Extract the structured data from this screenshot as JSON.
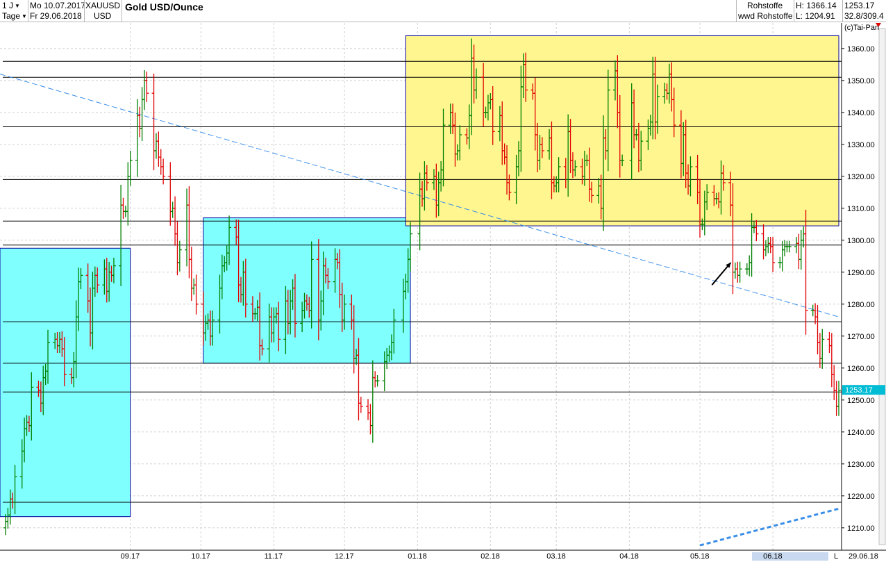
{
  "header": {
    "period": "1 J",
    "date_from": "Mo 10.07.2017",
    "date_to": "Fr 29.06.2018",
    "interval": "Tage",
    "symbol": "XAUUSD",
    "currency": "USD",
    "title": "Gold USD/Ounce",
    "group": "Rohstoffe",
    "group_source": "wwd Rohstoffe",
    "high": "H: 1366.14",
    "low": "L: 1204.91",
    "last": "1253.17",
    "range": "32.8/309.4",
    "copyright": "(c)Tai-Pan"
  },
  "footer": {
    "period_label": "06.18",
    "end_date": "29.06.18",
    "scale_mode": "L"
  },
  "chart_data": {
    "type": "ohlc",
    "title": "Gold USD/Ounce",
    "last_price": 1253.17,
    "ylim": [
      1203,
      1368
    ],
    "y_ticks": [
      1210,
      1220,
      1230,
      1240,
      1250,
      1260,
      1270,
      1280,
      1290,
      1300,
      1310,
      1320,
      1330,
      1340,
      1350,
      1360
    ],
    "y_tick_labels": [
      "1210.00",
      "1220.00",
      "1230.00",
      "1240.00",
      "1250.00",
      "1260.00",
      "1270.00",
      "1280.00",
      "1290.00",
      "1300.00",
      "1310.00",
      "1320.00",
      "1330.00",
      "1340.00",
      "1350.00",
      "1360.00"
    ],
    "x_ticks": [
      "09.17",
      "10.17",
      "11.17",
      "12.17",
      "01.18",
      "02.18",
      "03.18",
      "04.18",
      "05.18",
      "06.18"
    ],
    "grid": true,
    "colors": {
      "up": "#008000",
      "down": "#e00000",
      "yellow_zone": "#fff68f",
      "cyan_zone": "#80ffff",
      "zone_border": "#0000a0",
      "trendline": "#3a8ee6",
      "price_tag": "#00bcd4"
    },
    "horizontal_levels": [
      1218,
      1252.5,
      1261.5,
      1274.5,
      1298.5,
      1306,
      1319,
      1335.5,
      1351,
      1356
    ],
    "zones": [
      {
        "color": "cyan",
        "from": "2017-07-10",
        "to": "2017-09-01",
        "low": 1213.5,
        "high": 1297.5
      },
      {
        "color": "cyan",
        "from": "2017-10-02",
        "to": "2017-12-29",
        "low": 1261.5,
        "high": 1307
      },
      {
        "color": "yellow",
        "from": "2017-12-27",
        "to": "2018-06-29",
        "low": 1304.5,
        "high": 1364
      }
    ],
    "trendlines": [
      {
        "style": "dashed",
        "from": [
          "2017-07-10",
          1352
        ],
        "to": [
          "2018-06-29",
          1276
        ]
      },
      {
        "style": "dashed-bold",
        "from": [
          "2018-05-01",
          1204.5
        ],
        "to": [
          "2018-06-29",
          1216
        ]
      }
    ],
    "annotation_arrow": {
      "from": [
        "2018-05-02",
        1286
      ],
      "to": [
        "2018-05-10",
        1293
      ]
    },
    "series": [
      {
        "t": "2017-07-10",
        "c": 1212
      },
      {
        "t": "2017-07-11",
        "c": 1214
      },
      {
        "t": "2017-07-12",
        "c": 1219
      },
      {
        "t": "2017-07-13",
        "c": 1218
      },
      {
        "t": "2017-07-14",
        "c": 1226
      },
      {
        "t": "2017-07-17",
        "c": 1234
      },
      {
        "t": "2017-07-18",
        "c": 1241
      },
      {
        "t": "2017-07-19",
        "c": 1243
      },
      {
        "t": "2017-07-20",
        "c": 1242
      },
      {
        "t": "2017-07-21",
        "c": 1254
      },
      {
        "t": "2017-07-24",
        "c": 1253
      },
      {
        "t": "2017-07-25",
        "c": 1249
      },
      {
        "t": "2017-07-26",
        "c": 1257
      },
      {
        "t": "2017-07-27",
        "c": 1259
      },
      {
        "t": "2017-07-28",
        "c": 1268
      },
      {
        "t": "2017-07-31",
        "c": 1269
      },
      {
        "t": "2017-08-01",
        "c": 1267
      },
      {
        "t": "2017-08-02",
        "c": 1269
      },
      {
        "t": "2017-08-03",
        "c": 1266
      },
      {
        "t": "2017-08-04",
        "c": 1258
      },
      {
        "t": "2017-08-07",
        "c": 1257
      },
      {
        "t": "2017-08-08",
        "c": 1262
      },
      {
        "t": "2017-08-09",
        "c": 1276
      },
      {
        "t": "2017-08-10",
        "c": 1287
      },
      {
        "t": "2017-08-11",
        "c": 1289
      },
      {
        "t": "2017-08-14",
        "c": 1281
      },
      {
        "t": "2017-08-15",
        "c": 1271
      },
      {
        "t": "2017-08-16",
        "c": 1285
      },
      {
        "t": "2017-08-17",
        "c": 1289
      },
      {
        "t": "2017-08-18",
        "c": 1286
      },
      {
        "t": "2017-08-21",
        "c": 1291
      },
      {
        "t": "2017-08-22",
        "c": 1284
      },
      {
        "t": "2017-08-23",
        "c": 1290
      },
      {
        "t": "2017-08-24",
        "c": 1289
      },
      {
        "t": "2017-08-25",
        "c": 1292
      },
      {
        "t": "2017-08-28",
        "c": 1311
      },
      {
        "t": "2017-08-29",
        "c": 1309
      },
      {
        "t": "2017-08-30",
        "c": 1309
      },
      {
        "t": "2017-08-31",
        "c": 1320
      },
      {
        "t": "2017-09-01",
        "c": 1325
      },
      {
        "t": "2017-09-04",
        "c": 1339
      },
      {
        "t": "2017-09-05",
        "c": 1335
      },
      {
        "t": "2017-09-06",
        "c": 1344
      },
      {
        "t": "2017-09-07",
        "c": 1350
      },
      {
        "t": "2017-09-08",
        "c": 1346
      },
      {
        "t": "2017-09-11",
        "c": 1328
      },
      {
        "t": "2017-09-12",
        "c": 1331
      },
      {
        "t": "2017-09-13",
        "c": 1326
      },
      {
        "t": "2017-09-14",
        "c": 1323
      },
      {
        "t": "2017-09-15",
        "c": 1320
      },
      {
        "t": "2017-09-18",
        "c": 1309
      },
      {
        "t": "2017-09-19",
        "c": 1310
      },
      {
        "t": "2017-09-20",
        "c": 1302
      },
      {
        "t": "2017-09-21",
        "c": 1293
      },
      {
        "t": "2017-09-22",
        "c": 1297
      },
      {
        "t": "2017-09-25",
        "c": 1311
      },
      {
        "t": "2017-09-26",
        "c": 1294
      },
      {
        "t": "2017-09-27",
        "c": 1285
      },
      {
        "t": "2017-09-28",
        "c": 1286
      },
      {
        "t": "2017-09-29",
        "c": 1280
      },
      {
        "t": "2017-10-02",
        "c": 1271
      },
      {
        "t": "2017-10-03",
        "c": 1274
      },
      {
        "t": "2017-10-04",
        "c": 1275
      },
      {
        "t": "2017-10-05",
        "c": 1270
      },
      {
        "t": "2017-10-06",
        "c": 1275
      },
      {
        "t": "2017-10-09",
        "c": 1285
      },
      {
        "t": "2017-10-10",
        "c": 1292
      },
      {
        "t": "2017-10-11",
        "c": 1293
      },
      {
        "t": "2017-10-12",
        "c": 1296
      },
      {
        "t": "2017-10-13",
        "c": 1304
      },
      {
        "t": "2017-10-16",
        "c": 1301
      },
      {
        "t": "2017-10-17",
        "c": 1286
      },
      {
        "t": "2017-10-18",
        "c": 1283
      },
      {
        "t": "2017-10-19",
        "c": 1290
      },
      {
        "t": "2017-10-20",
        "c": 1280
      },
      {
        "t": "2017-10-23",
        "c": 1277
      },
      {
        "t": "2017-10-24",
        "c": 1277
      },
      {
        "t": "2017-10-25",
        "c": 1279
      },
      {
        "t": "2017-10-26",
        "c": 1267
      },
      {
        "t": "2017-10-27",
        "c": 1266
      },
      {
        "t": "2017-10-30",
        "c": 1276
      },
      {
        "t": "2017-10-31",
        "c": 1271
      },
      {
        "t": "2017-11-01",
        "c": 1276
      },
      {
        "t": "2017-11-02",
        "c": 1277
      },
      {
        "t": "2017-11-03",
        "c": 1269
      },
      {
        "t": "2017-11-06",
        "c": 1281
      },
      {
        "t": "2017-11-07",
        "c": 1274
      },
      {
        "t": "2017-11-08",
        "c": 1281
      },
      {
        "t": "2017-11-09",
        "c": 1285
      },
      {
        "t": "2017-11-10",
        "c": 1274
      },
      {
        "t": "2017-11-13",
        "c": 1278
      },
      {
        "t": "2017-11-14",
        "c": 1281
      },
      {
        "t": "2017-11-15",
        "c": 1280
      },
      {
        "t": "2017-11-16",
        "c": 1278
      },
      {
        "t": "2017-11-17",
        "c": 1294
      },
      {
        "t": "2017-11-20",
        "c": 1275
      },
      {
        "t": "2017-11-21",
        "c": 1281
      },
      {
        "t": "2017-11-22",
        "c": 1292
      },
      {
        "t": "2017-11-23",
        "c": 1289
      },
      {
        "t": "2017-11-24",
        "c": 1287
      },
      {
        "t": "2017-11-27",
        "c": 1294
      },
      {
        "t": "2017-11-28",
        "c": 1293
      },
      {
        "t": "2017-11-29",
        "c": 1283
      },
      {
        "t": "2017-11-30",
        "c": 1275
      },
      {
        "t": "2017-12-01",
        "c": 1280
      },
      {
        "t": "2017-12-04",
        "c": 1275
      },
      {
        "t": "2017-12-05",
        "c": 1263
      },
      {
        "t": "2017-12-06",
        "c": 1264
      },
      {
        "t": "2017-12-07",
        "c": 1249
      },
      {
        "t": "2017-12-08",
        "c": 1248
      },
      {
        "t": "2017-12-11",
        "c": 1246
      },
      {
        "t": "2017-12-12",
        "c": 1242
      },
      {
        "t": "2017-12-13",
        "c": 1257
      },
      {
        "t": "2017-12-14",
        "c": 1256
      },
      {
        "t": "2017-12-15",
        "c": 1256
      },
      {
        "t": "2017-12-18",
        "c": 1262
      },
      {
        "t": "2017-12-19",
        "c": 1264
      },
      {
        "t": "2017-12-20",
        "c": 1265
      },
      {
        "t": "2017-12-21",
        "c": 1268
      },
      {
        "t": "2017-12-22",
        "c": 1275
      },
      {
        "t": "2017-12-26",
        "c": 1284
      },
      {
        "t": "2017-12-27",
        "c": 1287
      },
      {
        "t": "2017-12-28",
        "c": 1294
      },
      {
        "t": "2017-12-29",
        "c": 1302
      },
      {
        "t": "2018-01-02",
        "c": 1316
      },
      {
        "t": "2018-01-03",
        "c": 1313
      },
      {
        "t": "2018-01-04",
        "c": 1321
      },
      {
        "t": "2018-01-05",
        "c": 1318
      },
      {
        "t": "2018-01-08",
        "c": 1320
      },
      {
        "t": "2018-01-09",
        "c": 1311
      },
      {
        "t": "2018-01-10",
        "c": 1318
      },
      {
        "t": "2018-01-11",
        "c": 1322
      },
      {
        "t": "2018-01-12",
        "c": 1336
      },
      {
        "t": "2018-01-15",
        "c": 1340
      },
      {
        "t": "2018-01-16",
        "c": 1336
      },
      {
        "t": "2018-01-17",
        "c": 1327
      },
      {
        "t": "2018-01-18",
        "c": 1328
      },
      {
        "t": "2018-01-19",
        "c": 1333
      },
      {
        "t": "2018-01-22",
        "c": 1332
      },
      {
        "t": "2018-01-23",
        "c": 1339
      },
      {
        "t": "2018-01-24",
        "c": 1357
      },
      {
        "t": "2018-01-25",
        "c": 1347
      },
      {
        "t": "2018-01-26",
        "c": 1351
      },
      {
        "t": "2018-01-29",
        "c": 1340
      },
      {
        "t": "2018-01-30",
        "c": 1340
      },
      {
        "t": "2018-01-31",
        "c": 1343
      },
      {
        "t": "2018-02-01",
        "c": 1344
      },
      {
        "t": "2018-02-02",
        "c": 1334
      },
      {
        "t": "2018-02-05",
        "c": 1339
      },
      {
        "t": "2018-02-06",
        "c": 1328
      },
      {
        "t": "2018-02-07",
        "c": 1326
      },
      {
        "t": "2018-02-08",
        "c": 1318
      },
      {
        "t": "2018-02-09",
        "c": 1315
      },
      {
        "t": "2018-02-12",
        "c": 1323
      },
      {
        "t": "2018-02-13",
        "c": 1328
      },
      {
        "t": "2018-02-14",
        "c": 1348
      },
      {
        "t": "2018-02-15",
        "c": 1355
      },
      {
        "t": "2018-02-16",
        "c": 1347
      },
      {
        "t": "2018-02-19",
        "c": 1346
      },
      {
        "t": "2018-02-20",
        "c": 1333
      },
      {
        "t": "2018-02-21",
        "c": 1325
      },
      {
        "t": "2018-02-22",
        "c": 1330
      },
      {
        "t": "2018-02-23",
        "c": 1328
      },
      {
        "t": "2018-02-26",
        "c": 1332
      },
      {
        "t": "2018-02-27",
        "c": 1318
      },
      {
        "t": "2018-02-28",
        "c": 1317
      },
      {
        "t": "2018-03-01",
        "c": 1318
      },
      {
        "t": "2018-03-02",
        "c": 1323
      },
      {
        "t": "2018-03-05",
        "c": 1319
      },
      {
        "t": "2018-03-06",
        "c": 1334
      },
      {
        "t": "2018-03-07",
        "c": 1325
      },
      {
        "t": "2018-03-08",
        "c": 1322
      },
      {
        "t": "2018-03-09",
        "c": 1323
      },
      {
        "t": "2018-03-12",
        "c": 1320
      },
      {
        "t": "2018-03-13",
        "c": 1325
      },
      {
        "t": "2018-03-14",
        "c": 1325
      },
      {
        "t": "2018-03-15",
        "c": 1316
      },
      {
        "t": "2018-03-16",
        "c": 1314
      },
      {
        "t": "2018-03-19",
        "c": 1317
      },
      {
        "t": "2018-03-20",
        "c": 1310
      },
      {
        "t": "2018-03-21",
        "c": 1332
      },
      {
        "t": "2018-03-22",
        "c": 1328
      },
      {
        "t": "2018-03-23",
        "c": 1347
      },
      {
        "t": "2018-03-26",
        "c": 1353
      },
      {
        "t": "2018-03-27",
        "c": 1340
      },
      {
        "t": "2018-03-28",
        "c": 1325
      },
      {
        "t": "2018-03-29",
        "c": 1325
      },
      {
        "t": "2018-04-02",
        "c": 1343
      },
      {
        "t": "2018-04-03",
        "c": 1333
      },
      {
        "t": "2018-04-04",
        "c": 1333
      },
      {
        "t": "2018-04-05",
        "c": 1325
      },
      {
        "t": "2018-04-06",
        "c": 1331
      },
      {
        "t": "2018-04-09",
        "c": 1335
      },
      {
        "t": "2018-04-10",
        "c": 1337
      },
      {
        "t": "2018-04-11",
        "c": 1352
      },
      {
        "t": "2018-04-12",
        "c": 1337
      },
      {
        "t": "2018-04-13",
        "c": 1345
      },
      {
        "t": "2018-04-16",
        "c": 1347
      },
      {
        "t": "2018-04-17",
        "c": 1346
      },
      {
        "t": "2018-04-18",
        "c": 1352
      },
      {
        "t": "2018-04-19",
        "c": 1344
      },
      {
        "t": "2018-04-20",
        "c": 1336
      },
      {
        "t": "2018-04-23",
        "c": 1324
      },
      {
        "t": "2018-04-24",
        "c": 1333
      },
      {
        "t": "2018-04-25",
        "c": 1321
      },
      {
        "t": "2018-04-26",
        "c": 1317
      },
      {
        "t": "2018-04-27",
        "c": 1323
      },
      {
        "t": "2018-04-30",
        "c": 1315
      },
      {
        "t": "2018-05-01",
        "c": 1305
      },
      {
        "t": "2018-05-02",
        "c": 1305
      },
      {
        "t": "2018-05-03",
        "c": 1312
      },
      {
        "t": "2018-05-04",
        "c": 1315
      },
      {
        "t": "2018-05-07",
        "c": 1313
      },
      {
        "t": "2018-05-08",
        "c": 1313
      },
      {
        "t": "2018-05-09",
        "c": 1312
      },
      {
        "t": "2018-05-10",
        "c": 1321
      },
      {
        "t": "2018-05-11",
        "c": 1318
      },
      {
        "t": "2018-05-14",
        "c": 1311
      },
      {
        "t": "2018-05-15",
        "c": 1290
      },
      {
        "t": "2018-05-16",
        "c": 1291
      },
      {
        "t": "2018-05-17",
        "c": 1289
      },
      {
        "t": "2018-05-18",
        "c": 1291
      },
      {
        "t": "2018-05-21",
        "c": 1291
      },
      {
        "t": "2018-05-22",
        "c": 1293
      },
      {
        "t": "2018-05-23",
        "c": 1304
      },
      {
        "t": "2018-05-24",
        "c": 1304
      },
      {
        "t": "2018-05-25",
        "c": 1302
      },
      {
        "t": "2018-05-28",
        "c": 1297
      },
      {
        "t": "2018-05-29",
        "c": 1298
      },
      {
        "t": "2018-05-30",
        "c": 1299
      },
      {
        "t": "2018-05-31",
        "c": 1298
      },
      {
        "t": "2018-06-01",
        "c": 1293
      },
      {
        "t": "2018-06-04",
        "c": 1293
      },
      {
        "t": "2018-06-05",
        "c": 1297
      },
      {
        "t": "2018-06-06",
        "c": 1298
      },
      {
        "t": "2018-06-07",
        "c": 1298
      },
      {
        "t": "2018-06-08",
        "c": 1298
      },
      {
        "t": "2018-06-11",
        "c": 1299
      },
      {
        "t": "2018-06-12",
        "c": 1294
      },
      {
        "t": "2018-06-13",
        "c": 1300
      },
      {
        "t": "2018-06-14",
        "c": 1302
      },
      {
        "t": "2018-06-15",
        "c": 1278
      },
      {
        "t": "2018-06-18",
        "c": 1278
      },
      {
        "t": "2018-06-19",
        "c": 1276
      },
      {
        "t": "2018-06-20",
        "c": 1268
      },
      {
        "t": "2018-06-21",
        "c": 1263
      },
      {
        "t": "2018-06-22",
        "c": 1269
      },
      {
        "t": "2018-06-25",
        "c": 1267
      },
      {
        "t": "2018-06-26",
        "c": 1258
      },
      {
        "t": "2018-06-27",
        "c": 1253
      },
      {
        "t": "2018-06-28",
        "c": 1248
      },
      {
        "t": "2018-06-29",
        "c": 1253
      }
    ]
  }
}
